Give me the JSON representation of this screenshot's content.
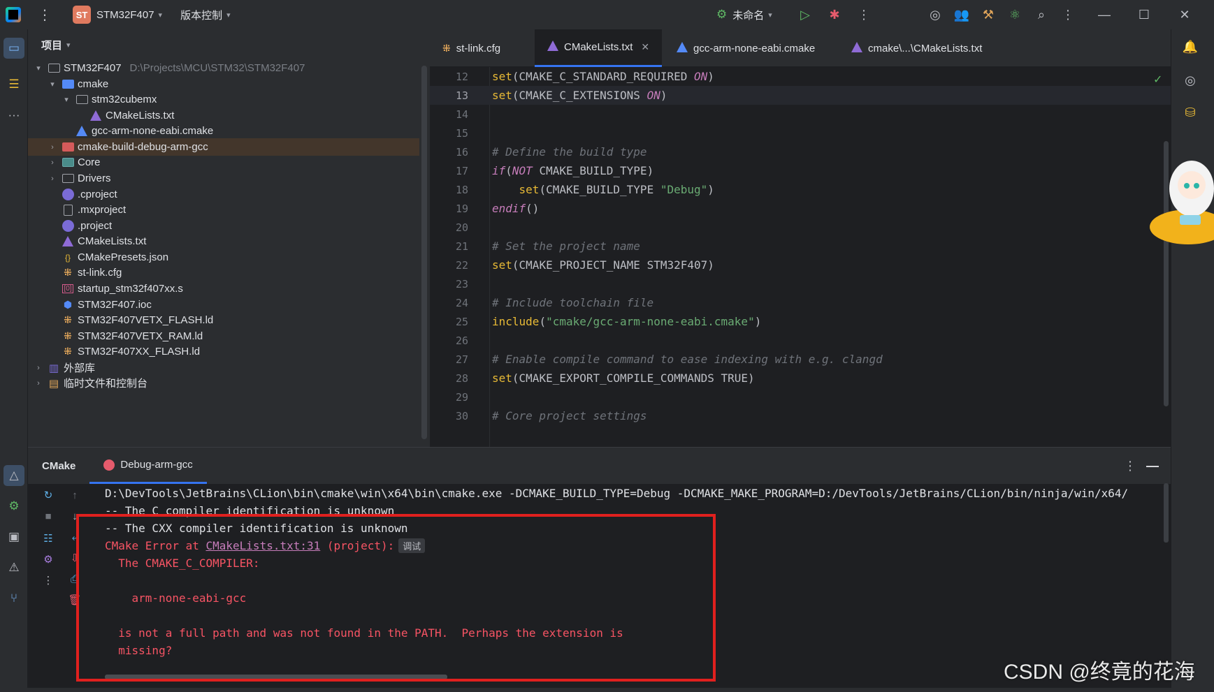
{
  "titlebar": {
    "project_badge": "ST",
    "project_name": "STM32F407",
    "vcs_label": "版本控制",
    "run_config": "未命名"
  },
  "project_panel": {
    "title": "项目",
    "tree": [
      {
        "label": "STM32F407",
        "hint": "D:\\Projects\\MCU\\STM32\\STM32F407"
      },
      {
        "label": "cmake"
      },
      {
        "label": "stm32cubemx"
      },
      {
        "label": "CMakeLists.txt"
      },
      {
        "label": "gcc-arm-none-eabi.cmake"
      },
      {
        "label": "cmake-build-debug-arm-gcc"
      },
      {
        "label": "Core"
      },
      {
        "label": "Drivers"
      },
      {
        "label": ".cproject"
      },
      {
        "label": ".mxproject"
      },
      {
        "label": ".project"
      },
      {
        "label": "CMakeLists.txt"
      },
      {
        "label": "CMakePresets.json"
      },
      {
        "label": "st-link.cfg"
      },
      {
        "label": "startup_stm32f407xx.s"
      },
      {
        "label": "STM32F407.ioc"
      },
      {
        "label": "STM32F407VETX_FLASH.ld"
      },
      {
        "label": "STM32F407VETX_RAM.ld"
      },
      {
        "label": "STM32F407XX_FLASH.ld"
      },
      {
        "label": "外部库"
      },
      {
        "label": "临时文件和控制台"
      }
    ]
  },
  "editor": {
    "tabs": [
      {
        "label": "st-link.cfg"
      },
      {
        "label": "CMakeLists.txt",
        "close": "✕"
      },
      {
        "label": "gcc-arm-none-eabi.cmake"
      },
      {
        "label": "cmake\\...\\CMakeLists.txt"
      }
    ],
    "line_numbers": [
      "12",
      "13",
      "14",
      "15",
      "16",
      "17",
      "18",
      "19",
      "20",
      "21",
      "22",
      "23",
      "24",
      "25",
      "26",
      "27",
      "28",
      "29",
      "30"
    ],
    "code": {
      "l12_fn": "set",
      "l12_a": "(CMAKE_C_STANDARD_REQUIRED ",
      "l12_b": "ON",
      "l12_c": ")",
      "l13_fn": "set",
      "l13_a": "(CMAKE_C_EXTENSIONS ",
      "l13_b": "ON",
      "l13_c": ")",
      "l16": "# Define the build type",
      "l17_a": "if",
      "l17_b": "(",
      "l17_c": "NOT",
      "l17_d": " CMAKE_BUILD_TYPE)",
      "l18_fn": "set",
      "l18_a": "(CMAKE_BUILD_TYPE ",
      "l18_b": "\"Debug\"",
      "l18_c": ")",
      "l19_a": "endif",
      "l19_b": "()",
      "l21": "# Set the project name",
      "l22_fn": "set",
      "l22_a": "(CMAKE_PROJECT_NAME STM32F407)",
      "l24": "# Include toolchain file",
      "l25_fn": "include",
      "l25_a": "(",
      "l25_b": "\"cmake/gcc-arm-none-eabi.cmake\"",
      "l25_c": ")",
      "l27": "# Enable compile command to ease indexing with e.g. clangd",
      "l28_fn": "set",
      "l28_a": "(CMAKE_EXPORT_COMPILE_COMMANDS TRUE)",
      "l30": "# Core project settings"
    }
  },
  "bottom_panel": {
    "tab_cmake": "CMake",
    "tab_profile": "Debug-arm-gcc",
    "console": {
      "cmd": "D:\\DevTools\\JetBrains\\CLion\\bin\\cmake\\win\\x64\\bin\\cmake.exe -DCMAKE_BUILD_TYPE=Debug -DCMAKE_MAKE_PROGRAM=D:/DevTools/JetBrains/CLion/bin/ninja/win/x64/",
      "c_id": "-- The C compiler identification is unknown",
      "cxx_id": "-- The CXX compiler identification is unknown",
      "err_prefix": "CMake Error at ",
      "err_link": "CMakeLists.txt:31",
      "err_suffix": " (project):",
      "debug_badge": "调试",
      "l1": "  The CMAKE_C_COMPILER:",
      "l2": "    arm-none-eabi-gcc",
      "l3": "  is not a full path and was not found in the PATH.  Perhaps the extension is",
      "l4": "  missing?"
    }
  },
  "watermark": "CSDN @终竟的花海",
  "colors": {
    "accent": "#3574f0",
    "error": "#f75464",
    "highlight_box": "#e0201e"
  }
}
